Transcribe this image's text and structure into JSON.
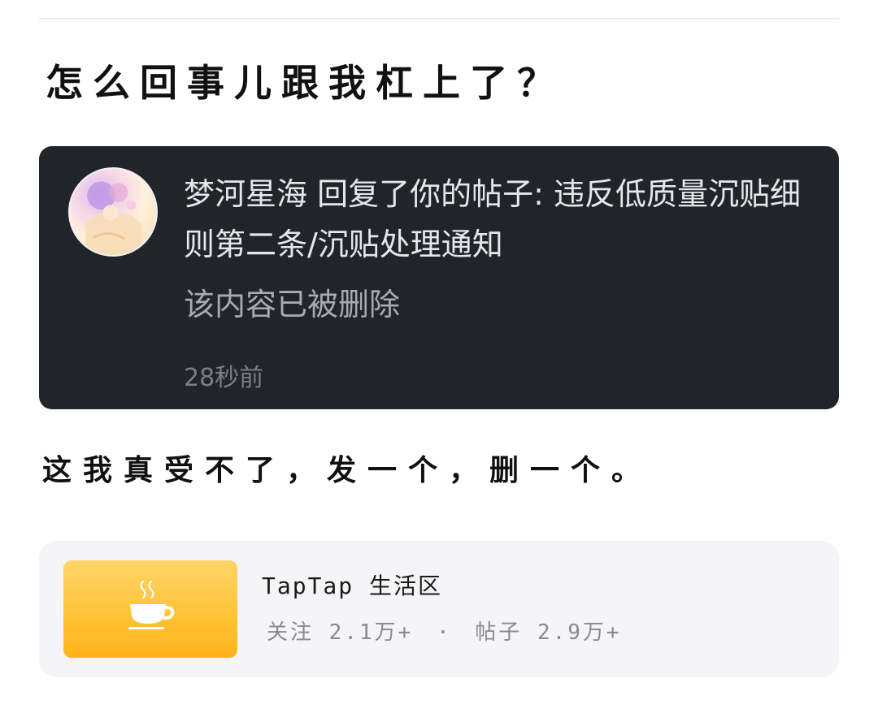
{
  "post": {
    "title": "怎么回事儿跟我杠上了？",
    "body": "这我真受不了，发一个，删一个。"
  },
  "notification": {
    "message": "梦河星海 回复了你的帖子: 违反低质量沉贴细则第二条/沉贴处理通知",
    "status": "该内容已被删除",
    "time": "28秒前"
  },
  "forum": {
    "name": "TapTap 生活区",
    "follow_label": "关注",
    "follow_count": "2.1万+",
    "separator": "·",
    "posts_label": "帖子",
    "posts_count": "2.9万+",
    "icon": "coffee-cup-icon",
    "icon_bg_color": "#ffc233"
  },
  "colors": {
    "notification_bg": "#21242b",
    "forum_card_bg": "#f5f5f7"
  }
}
